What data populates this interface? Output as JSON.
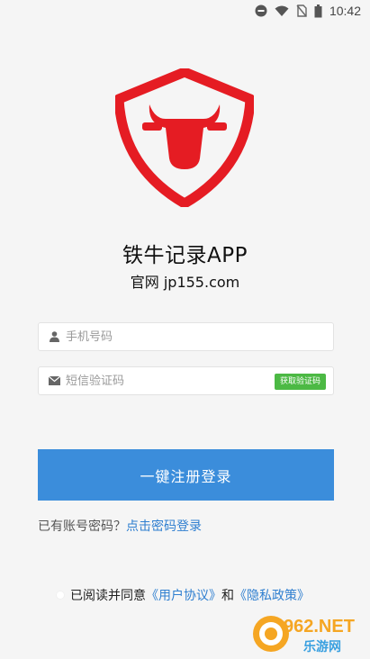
{
  "status_bar": {
    "time": "10:42",
    "icons": [
      "do-not-disturb-icon",
      "wifi-icon",
      "no-sim-icon",
      "battery-icon"
    ]
  },
  "app": {
    "name": "铁牛记录APP",
    "site": "官网 jp155.com",
    "logo_color": "#e51c23"
  },
  "form": {
    "phone_placeholder": "手机号码",
    "code_placeholder": "短信验证码",
    "get_code_label": "获取验证码",
    "submit_label": "一键注册登录"
  },
  "alt_login": {
    "prompt": "已有账号密码？",
    "link": "点击密码登录"
  },
  "agreement": {
    "prefix": "已阅读并同意",
    "user_agreement": "《用户协议》",
    "and": "和",
    "privacy_policy": "《隐私政策》"
  },
  "watermark": {
    "brand": "962.NET",
    "sub": "乐游网"
  },
  "colors": {
    "primary": "#3b8ddb",
    "code_button": "#4cb944",
    "link": "#2f7fd0",
    "logo": "#e51c23"
  }
}
